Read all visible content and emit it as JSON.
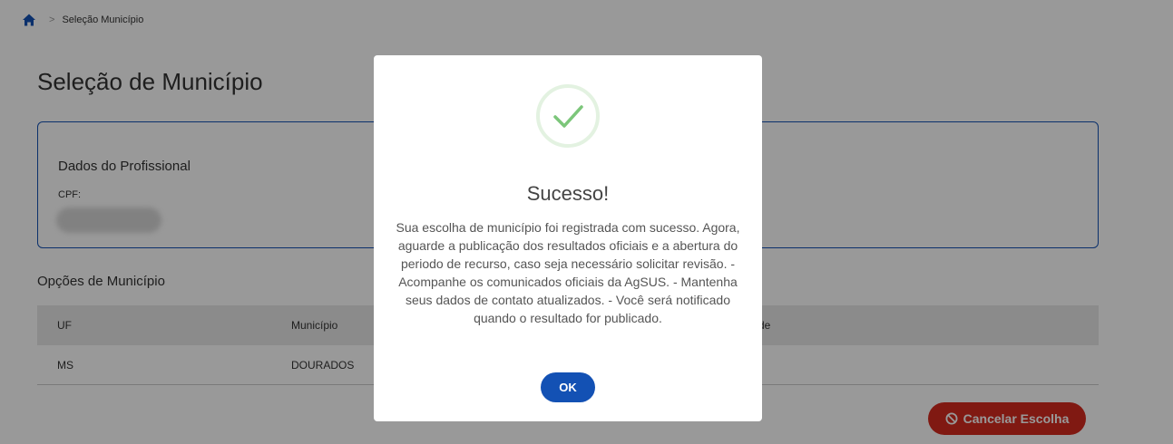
{
  "breadcrumb": {
    "home_icon": "home-icon",
    "separator": ">",
    "current": "Seleção Município"
  },
  "page": {
    "title": "Seleção de Município"
  },
  "profissional": {
    "section_title": "Dados do Profissional",
    "cpf_label": "CPF:"
  },
  "opcoes": {
    "section_title": "Opções de Município",
    "columns": [
      "UF",
      "Município",
      "de"
    ],
    "rows": [
      {
        "uf": "MS",
        "municipio": "DOURADOS"
      }
    ]
  },
  "actions": {
    "cancel_label": "Cancelar Escolha",
    "cancel_icon": "ban-icon"
  },
  "modal": {
    "icon": "check-circle-icon",
    "title": "Sucesso!",
    "message": "Sua escolha de município foi registrada com sucesso. Agora, aguarde a publicação dos resultados oficiais e a abertura do periodo de recurso, caso seja necessário solicitar revisão. - Acompanhe os comunicados oficiais da AgSUS. - Mantenha seus dados de contato atualizados. - Você será notificado quando o resultado for publicado.",
    "ok_label": "OK"
  },
  "colors": {
    "primary": "#1351b4",
    "danger": "#d62a1e",
    "success": "#7cc67a",
    "table_header": "#e8e8e8"
  }
}
